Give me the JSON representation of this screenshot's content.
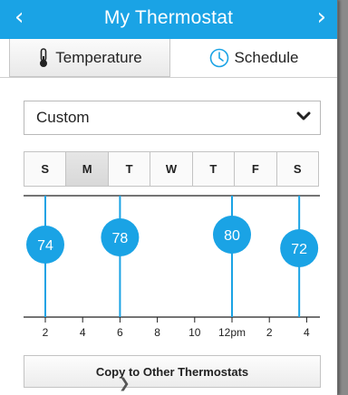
{
  "header": {
    "title": "My Thermostat",
    "prev_icon": "chevron-left-icon",
    "next_icon": "chevron-right-icon",
    "prev_glyph": "‹",
    "next_glyph": "›",
    "color": "#1aa3e5"
  },
  "tabs": [
    {
      "label": "Temperature",
      "icon": "thermometer-icon"
    },
    {
      "label": "Schedule",
      "icon": "clock-icon"
    }
  ],
  "dropdown": {
    "value": "Custom",
    "icon": "chevron-down-icon"
  },
  "days": [
    {
      "label": "S"
    },
    {
      "label": "M",
      "selected": true
    },
    {
      "label": "T"
    },
    {
      "label": "W"
    },
    {
      "label": "T"
    },
    {
      "label": "F"
    },
    {
      "label": "S"
    }
  ],
  "schedule": {
    "ticks": [
      "2",
      "4",
      "6",
      "8",
      "10",
      "12pm",
      "2",
      "4"
    ],
    "setpoints": [
      {
        "temp": "74",
        "hour": 2
      },
      {
        "temp": "78",
        "hour": 6
      },
      {
        "temp": "80",
        "hour": 12
      },
      {
        "temp": "72",
        "hour": 15.6
      }
    ],
    "accent": "#1aa3e5"
  },
  "copy_button": {
    "label": "Copy to Other Thermostats"
  },
  "cursor": {
    "icon": "cursor-arrow-icon",
    "glyph": "❯"
  }
}
